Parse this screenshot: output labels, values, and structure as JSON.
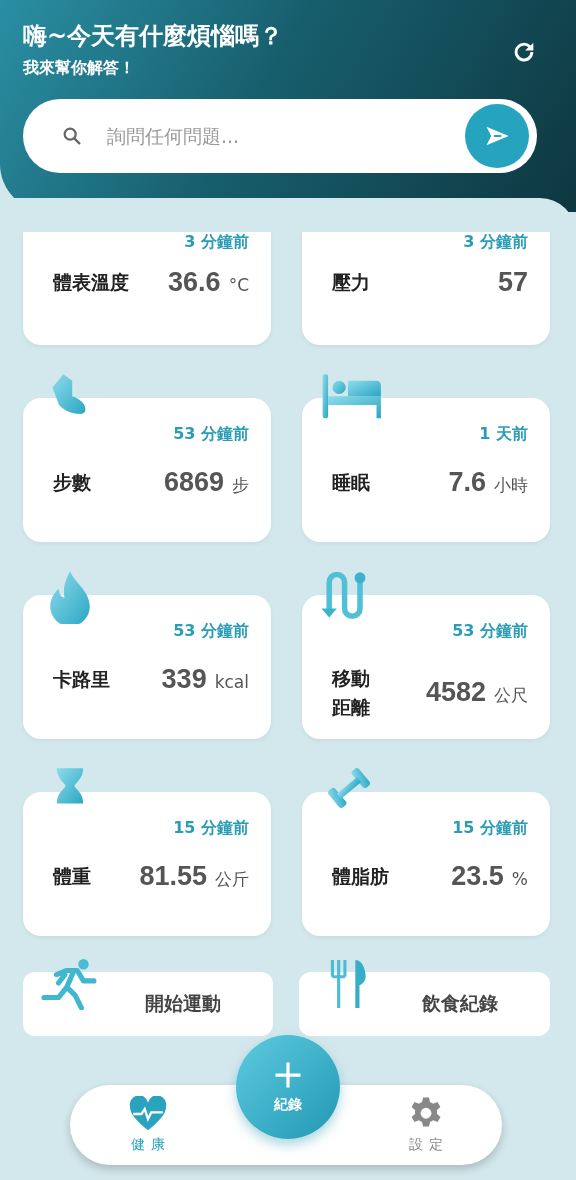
{
  "header": {
    "title": "嗨~今天有什麼煩惱嗎？",
    "subtitle": "我來幫你解答！"
  },
  "search": {
    "placeholder": "詢問任何問題..."
  },
  "cards": [
    {
      "kind": "temperature",
      "time": "3 分鐘前",
      "label": [
        "體表溫度"
      ],
      "value": "36.6",
      "unit": "°C"
    },
    {
      "kind": "pressure",
      "time": "3 分鐘前",
      "label": [
        "壓力"
      ],
      "value": "57"
    },
    {
      "kind": "steps",
      "time": "53 分鐘前",
      "label": [
        "步數"
      ],
      "value": "6869",
      "unit": "步"
    },
    {
      "kind": "sleep",
      "time": "1 天前",
      "label": [
        "睡眠"
      ],
      "value": "7.6",
      "unit": "小時"
    },
    {
      "kind": "calories",
      "time": "53 分鐘前",
      "label": [
        "卡路里"
      ],
      "value": "339",
      "unit": "kcal"
    },
    {
      "kind": "distance",
      "time": "53 分鐘前",
      "label": [
        "移動",
        "距離"
      ],
      "value": "4582",
      "unit": "公尺"
    },
    {
      "kind": "weight",
      "time": "15 分鐘前",
      "label": [
        "體重"
      ],
      "value": "81.55",
      "unit": "公斤"
    },
    {
      "kind": "bodyfat",
      "time": "15 分鐘前",
      "label": [
        "體脂肪"
      ],
      "value": "23.5",
      "unit": "%"
    }
  ],
  "actions": [
    {
      "kind": "exercise",
      "label": "開始運動"
    },
    {
      "kind": "diet",
      "label": "飲食紀錄"
    }
  ],
  "nav": {
    "items": [
      {
        "kind": "health",
        "label": "健康",
        "selected": true
      },
      {
        "kind": "settings",
        "label": "設定",
        "selected": false
      }
    ],
    "fab": "紀錄"
  }
}
